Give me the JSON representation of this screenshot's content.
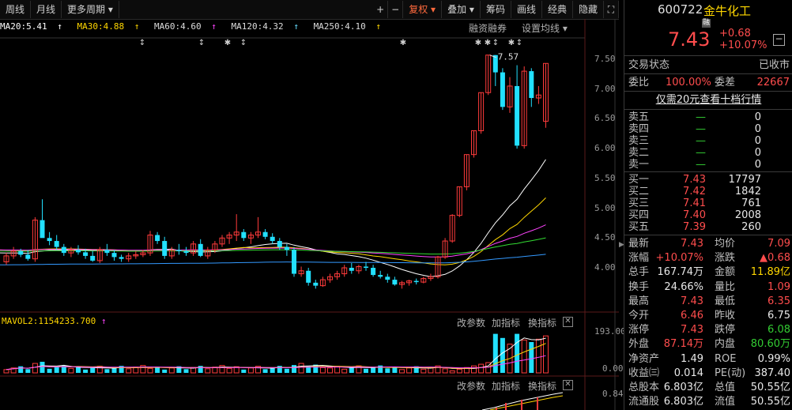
{
  "toolbar": {
    "left": [
      "周线",
      "月线",
      "更多周期"
    ],
    "right": [
      "+",
      "−",
      "复权",
      "叠加",
      "筹码",
      "画线",
      "经典",
      "隐藏"
    ],
    "selected": "复权"
  },
  "ma_legend": [
    {
      "label": "MA20:5.41",
      "color": "#ffffff"
    },
    {
      "label": "MA30:4.88",
      "color": "#ffd700"
    },
    {
      "label": "MA60:4.60",
      "color": "#ff44ff"
    },
    {
      "label": "MA120:4.32",
      "color": "#33dd33"
    },
    {
      "label": "MA250:4.10",
      "color": "#3399ff"
    }
  ],
  "chart_links": [
    "融资融券",
    "设置均线"
  ],
  "price_axis": [
    "7.50",
    "7.00",
    "6.50",
    "6.00",
    "5.50",
    "5.00",
    "4.50",
    "4.00"
  ],
  "peak_label": "7.57",
  "vol_panel": {
    "legend": "MAVOL2:1154233.700",
    "links": [
      "改参数",
      "加指标",
      "换指标"
    ],
    "axis": [
      "193.00",
      "0.00"
    ]
  },
  "ind_panel": {
    "links": [
      "改参数",
      "加指标",
      "换指标"
    ],
    "axis": [
      "0.84"
    ]
  },
  "quote": {
    "code": "600722",
    "name": "金牛化工",
    "tag": "融",
    "price": "7.43",
    "change": "+0.68",
    "change_pct": "+10.07%",
    "status_label": "交易状态",
    "status": "已收市",
    "weibi_label": "委比",
    "weibi": "100.00%",
    "weicha_label": "委差",
    "weicha": "22667",
    "promo": "仅需20元查看十档行情",
    "sells": [
      {
        "label": "卖五",
        "price": "—",
        "vol": "0"
      },
      {
        "label": "卖四",
        "price": "—",
        "vol": "0"
      },
      {
        "label": "卖三",
        "price": "—",
        "vol": "0"
      },
      {
        "label": "卖二",
        "price": "—",
        "vol": "0"
      },
      {
        "label": "卖一",
        "price": "—",
        "vol": "0"
      }
    ],
    "buys": [
      {
        "label": "买一",
        "price": "7.43",
        "vol": "17797"
      },
      {
        "label": "买二",
        "price": "7.42",
        "vol": "1842"
      },
      {
        "label": "买三",
        "price": "7.41",
        "vol": "761"
      },
      {
        "label": "买四",
        "price": "7.40",
        "vol": "2008"
      },
      {
        "label": "买五",
        "price": "7.39",
        "vol": "260"
      }
    ],
    "stats": [
      {
        "l1": "最新",
        "v1": "7.43",
        "c1": "red",
        "l2": "均价",
        "v2": "7.09",
        "c2": "red"
      },
      {
        "l1": "涨幅",
        "v1": "+10.07%",
        "c1": "red",
        "l2": "涨跌",
        "v2": "▲0.68",
        "c2": "red"
      },
      {
        "l1": "总手",
        "v1": "167.74万",
        "c1": "white",
        "l2": "金额",
        "v2": "11.89亿",
        "c2": "yellow"
      },
      {
        "l1": "换手",
        "v1": "24.66%",
        "c1": "white",
        "l2": "量比",
        "v2": "1.09",
        "c2": "red"
      },
      {
        "l1": "最高",
        "v1": "7.43",
        "c1": "red",
        "l2": "最低",
        "v2": "6.35",
        "c2": "red"
      },
      {
        "l1": "今开",
        "v1": "6.46",
        "c1": "red",
        "l2": "昨收",
        "v2": "6.75",
        "c2": "white"
      },
      {
        "l1": "涨停",
        "v1": "7.43",
        "c1": "red",
        "l2": "跌停",
        "v2": "6.08",
        "c2": "green"
      },
      {
        "l1": "外盘",
        "v1": "87.14万",
        "c1": "red",
        "l2": "内盘",
        "v2": "80.60万",
        "c2": "green"
      },
      {
        "l1": "净资产",
        "v1": "1.49",
        "c1": "white",
        "l2": "ROE",
        "v2": "0.99%",
        "c2": "white"
      },
      {
        "l1": "收益㈢",
        "v1": "0.014",
        "c1": "white",
        "l2": "PE(动)",
        "v2": "387.40",
        "c2": "white"
      },
      {
        "l1": "总股本",
        "v1": "6.803亿",
        "c1": "white",
        "l2": "总值",
        "v2": "50.55亿",
        "c2": "white"
      },
      {
        "l1": "流通股",
        "v1": "6.803亿",
        "c1": "white",
        "l2": "流值",
        "v2": "50.55亿",
        "c2": "white"
      }
    ]
  },
  "candles": [
    [
      4.1,
      4.25,
      4.05,
      4.2
    ],
    [
      4.2,
      4.35,
      4.15,
      4.28
    ],
    [
      4.28,
      4.32,
      4.18,
      4.22
    ],
    [
      4.22,
      4.3,
      4.12,
      4.15
    ],
    [
      4.15,
      4.85,
      4.1,
      4.8
    ],
    [
      4.8,
      5.15,
      4.7,
      4.5
    ],
    [
      4.5,
      4.6,
      4.38,
      4.45
    ],
    [
      4.45,
      4.55,
      4.3,
      4.35
    ],
    [
      4.35,
      4.4,
      4.2,
      4.25
    ],
    [
      4.25,
      4.35,
      4.18,
      4.3
    ],
    [
      4.3,
      4.38,
      4.22,
      4.26
    ],
    [
      4.26,
      4.32,
      4.15,
      4.2
    ],
    [
      4.2,
      4.28,
      4.1,
      4.12
    ],
    [
      4.12,
      4.35,
      4.08,
      4.3
    ],
    [
      4.3,
      4.4,
      4.2,
      4.25
    ],
    [
      4.25,
      4.3,
      4.12,
      4.18
    ],
    [
      4.18,
      4.22,
      4.1,
      4.15
    ],
    [
      4.15,
      4.25,
      4.1,
      4.2
    ],
    [
      4.2,
      4.28,
      4.15,
      4.22
    ],
    [
      4.22,
      4.3,
      4.18,
      4.25
    ],
    [
      4.25,
      4.62,
      4.2,
      4.55
    ],
    [
      4.55,
      4.6,
      4.4,
      4.45
    ],
    [
      4.45,
      4.52,
      4.15,
      4.2
    ],
    [
      4.2,
      4.35,
      4.15,
      4.3
    ],
    [
      4.3,
      4.4,
      4.22,
      4.28
    ],
    [
      4.28,
      4.35,
      4.2,
      4.25
    ],
    [
      4.25,
      4.45,
      4.2,
      4.4
    ],
    [
      4.4,
      4.48,
      4.18,
      4.2
    ],
    [
      4.2,
      4.35,
      4.15,
      4.3
    ],
    [
      4.3,
      4.45,
      4.25,
      4.4
    ],
    [
      4.4,
      4.55,
      4.35,
      4.5
    ],
    [
      4.5,
      4.6,
      4.4,
      4.55
    ],
    [
      4.55,
      4.9,
      4.45,
      4.6
    ],
    [
      4.6,
      4.65,
      4.45,
      4.5
    ],
    [
      4.5,
      4.6,
      4.4,
      4.55
    ],
    [
      4.55,
      4.85,
      4.5,
      4.6
    ],
    [
      4.6,
      4.65,
      4.48,
      4.52
    ],
    [
      4.52,
      4.58,
      4.4,
      4.45
    ],
    [
      4.45,
      4.5,
      4.3,
      4.35
    ],
    [
      4.35,
      4.4,
      4.2,
      4.3
    ],
    [
      4.3,
      4.35,
      3.85,
      3.9
    ],
    [
      3.9,
      4.02,
      3.85,
      3.95
    ],
    [
      3.95,
      4.0,
      3.7,
      3.75
    ],
    [
      3.75,
      3.8,
      3.65,
      3.7
    ],
    [
      3.7,
      3.85,
      3.68,
      3.8
    ],
    [
      3.8,
      3.9,
      3.75,
      3.85
    ],
    [
      3.85,
      3.95,
      3.8,
      3.9
    ],
    [
      3.9,
      4.05,
      3.85,
      4.0
    ],
    [
      4.0,
      4.08,
      3.9,
      3.95
    ],
    [
      3.95,
      4.05,
      3.9,
      4.02
    ],
    [
      4.02,
      4.1,
      3.95,
      4.0
    ],
    [
      4.0,
      4.05,
      3.85,
      3.88
    ],
    [
      3.88,
      3.95,
      3.82,
      3.85
    ],
    [
      3.85,
      3.9,
      3.75,
      3.8
    ],
    [
      3.8,
      3.85,
      3.7,
      3.72
    ],
    [
      3.72,
      3.78,
      3.65,
      3.75
    ],
    [
      3.75,
      3.8,
      3.7,
      3.78
    ],
    [
      3.78,
      3.82,
      3.72,
      3.76
    ],
    [
      3.76,
      3.85,
      3.74,
      3.82
    ],
    [
      3.82,
      3.9,
      3.78,
      3.85
    ],
    [
      3.85,
      4.2,
      3.82,
      4.18
    ],
    [
      4.18,
      4.5,
      4.15,
      4.45
    ],
    [
      4.45,
      4.9,
      4.42,
      4.88
    ],
    [
      4.88,
      5.36,
      4.85,
      5.36
    ],
    [
      5.36,
      5.9,
      5.3,
      5.9
    ],
    [
      5.9,
      6.3,
      5.85,
      6.3
    ],
    [
      6.3,
      6.94,
      6.25,
      6.94
    ],
    [
      6.94,
      7.57,
      6.9,
      7.57
    ],
    [
      7.57,
      7.57,
      7.05,
      7.28
    ],
    [
      7.28,
      7.35,
      6.65,
      6.7
    ],
    [
      6.7,
      7.2,
      6.6,
      7.05
    ],
    [
      7.05,
      7.4,
      6.0,
      6.05
    ],
    [
      6.05,
      7.38,
      6.0,
      7.3
    ],
    [
      7.3,
      7.35,
      6.7,
      6.85
    ],
    [
      6.85,
      7.05,
      6.75,
      6.9
    ],
    [
      6.46,
      7.43,
      6.35,
      7.43
    ]
  ]
}
